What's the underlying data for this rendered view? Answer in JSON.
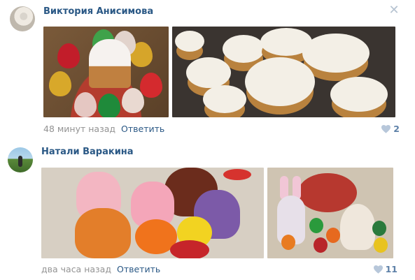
{
  "comments": [
    {
      "author": "Виктория Анисимова",
      "time": "48 минут назад",
      "reply_label": "Ответить",
      "likes": "2",
      "close_icon": "close-icon",
      "photos": [
        "easter-cake-eggs-photo",
        "kulich-tray-photo"
      ]
    },
    {
      "author": "Натали Варакина",
      "time": "два часа назад",
      "reply_label": "Ответить",
      "likes": "11",
      "photos": [
        "crochet-egg-hats-photo",
        "easter-bunny-eggs-photo"
      ]
    }
  ],
  "colors": {
    "link": "#2a5885",
    "meta": "#939393",
    "like_count": "#5e81a8",
    "heart": "#b7c7da"
  }
}
